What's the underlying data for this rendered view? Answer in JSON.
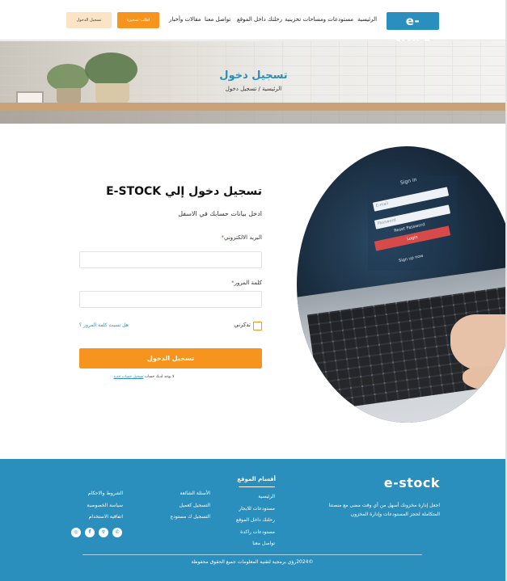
{
  "header": {
    "logo_text": "e-stock",
    "nav": [
      "الرئيسية",
      "مستودعات ومساحات تخزينية",
      "رحلتك داخل الموقع",
      "تواصل معنا",
      "مقالات وأخبار"
    ],
    "join_button": "اطلب تسعيرة",
    "login_button": "تسجيل الدخول"
  },
  "hero": {
    "title": "تسجيل دخول",
    "breadcrumb_home": "الرئيسية",
    "breadcrumb_sep": "/",
    "breadcrumb_current": "تسجيل دخول"
  },
  "photo": {
    "sign_in": "Sign in",
    "email_placeholder": "E-mail",
    "password_placeholder": "Password",
    "reset_password": "Reset Password",
    "login": "Login",
    "sign_up": "Sign up now"
  },
  "form": {
    "title": "تسجيل دخول إلي E-STOCK",
    "subtitle": "ادخل بيانات حسابك  في الاسفل",
    "email_label": "البريد الالكتروني",
    "password_label": "كلمة المرور",
    "required_mark": "*",
    "remember_me": "تذكرني",
    "forgot_password": "هل نسيت كلمة المرور ؟",
    "submit": "تسجيل الدخول",
    "no_account": "لا يوجد لديك حساب",
    "signup_link": "تسجيل حساب جديد"
  },
  "footer": {
    "logo_text": "e-stock",
    "description": "اجعل إدارة مخزونك أسهل من أي وقت مضى مع منصتنا المتكاملة لحجز المستودعات وإدارة المخزون",
    "sections_title": "أقسام الموقع",
    "col1": [
      "الرئيسية",
      "مستودعات للايجار",
      "رحلتك داخل الموقع",
      "مستودعات راكدة",
      "تواصل معنا"
    ],
    "col2": [
      "الأسئلة الشائعة",
      "التسجيل كعميل",
      "التسجيل ك مستودع"
    ],
    "col3": [
      "الشروط والاحكام",
      "سياسة الخصوصية",
      "اتفاقية الاستخدام"
    ],
    "socials": [
      "instagram-icon",
      "facebook-icon",
      "snapchat-icon",
      "whatsapp-icon"
    ],
    "copyright": "©2024رؤي برمجية لتقنية المعلومات جميع الحقوق محفوظة"
  },
  "colors": {
    "brand_blue": "#2b8fbd",
    "accent_orange": "#f7941d",
    "light_orange": "#fbe3c6"
  }
}
